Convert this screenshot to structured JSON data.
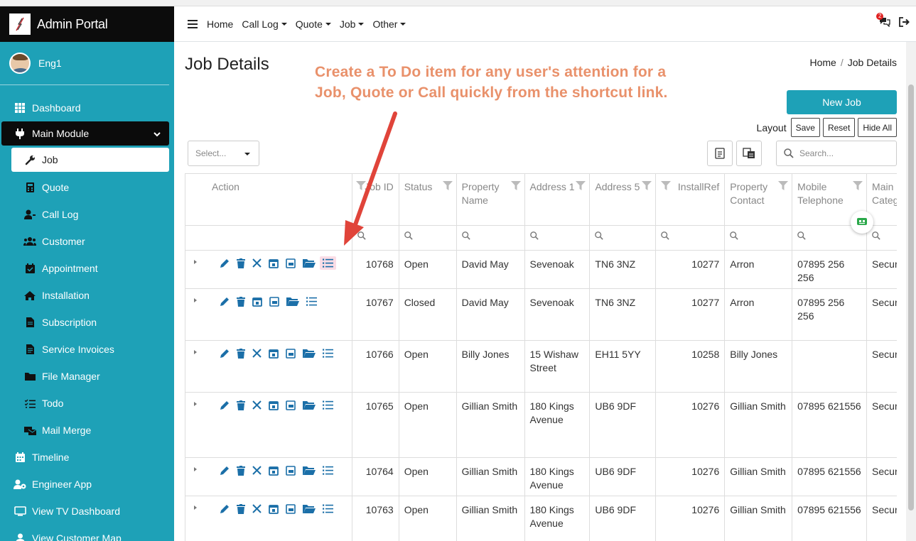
{
  "app": {
    "title": "Admin Portal"
  },
  "user": {
    "name": "Eng1"
  },
  "sidebar": {
    "items_top": [
      {
        "label": "Dashboard",
        "icon": "dashboard-icon"
      }
    ],
    "module": {
      "label": "Main Module",
      "icon": "plug-icon"
    },
    "sub_items": [
      {
        "label": "Job",
        "icon": "wrench-icon",
        "active": true
      },
      {
        "label": "Quote",
        "icon": "calculator-icon"
      },
      {
        "label": "Call Log",
        "icon": "user-call-icon"
      },
      {
        "label": "Customer",
        "icon": "users-icon"
      },
      {
        "label": "Appointment",
        "icon": "calendar-check-icon"
      },
      {
        "label": "Installation",
        "icon": "home-icon"
      },
      {
        "label": "Subscription",
        "icon": "file-icon"
      },
      {
        "label": "Service Invoices",
        "icon": "invoice-icon"
      },
      {
        "label": "File Manager",
        "icon": "folder-icon"
      },
      {
        "label": "Todo",
        "icon": "list-check-icon"
      },
      {
        "label": "Mail Merge",
        "icon": "mail-merge-icon"
      }
    ],
    "items_bottom": [
      {
        "label": "Timeline",
        "icon": "calendar-icon"
      },
      {
        "label": "Engineer App",
        "icon": "users-gear-icon"
      },
      {
        "label": "View TV Dashboard",
        "icon": "tv-icon"
      },
      {
        "label": "View Customer Map",
        "icon": "map-users-icon"
      }
    ]
  },
  "topnav": {
    "home": "Home",
    "menus": [
      "Call Log",
      "Quote",
      "Job",
      "Other"
    ],
    "notification_count": "2"
  },
  "page": {
    "title": "Job Details",
    "breadcrumb_home": "Home",
    "breadcrumb_current": "Job Details",
    "callout_line1": "Create a To Do item for any user's attention for a",
    "callout_line2": "Job, Quote or Call quickly from the shortcut link.",
    "new_job_label": "New Job",
    "layout_label": "Layout",
    "save_label": "Save",
    "reset_label": "Reset",
    "hide_all_label": "Hide All",
    "select_placeholder": "Select...",
    "search_placeholder": "Search..."
  },
  "grid": {
    "columns": {
      "action": "Action",
      "job_id": "Job ID",
      "status": "Status",
      "property_name": "Property Name",
      "address1": "Address 1",
      "address5": "Address 5",
      "install_ref": "InstallRef",
      "property_contact": "Property Contact",
      "mobile": "Mobile Telephone",
      "main_category": "Main Categ"
    },
    "rows": [
      {
        "job_id": "10768",
        "status": "Open",
        "property_name": "David May",
        "address1": "Sevenoak",
        "address5": "TN6 3NZ",
        "install_ref": "10277",
        "contact": "Arron",
        "mobile": "07895 256 256",
        "category": "Securi",
        "has_close": true,
        "highlight_todo": true
      },
      {
        "job_id": "10767",
        "status": "Closed",
        "property_name": "David May",
        "address1": "Sevenoak",
        "address5": "TN6 3NZ",
        "install_ref": "10277",
        "contact": "Arron",
        "mobile": "07895 256 256",
        "category": "Securi",
        "has_close": false,
        "highlight_todo": false
      },
      {
        "job_id": "10766",
        "status": "Open",
        "property_name": "Billy Jones",
        "address1": "15 Wishaw Street",
        "address5": "EH11 5YY",
        "install_ref": "10258",
        "contact": "Billy Jones",
        "mobile": "",
        "category": "Securi",
        "has_close": true,
        "highlight_todo": false
      },
      {
        "job_id": "10765",
        "status": "Open",
        "property_name": "Gillian Smith",
        "address1": "180 Kings Avenue",
        "address5": "UB6 9DF",
        "install_ref": "10276",
        "contact": "Gillian Smith",
        "mobile": "07895 621556",
        "category": "Securi",
        "has_close": true,
        "highlight_todo": false
      },
      {
        "job_id": "10764",
        "status": "Open",
        "property_name": "Gillian Smith",
        "address1": "180 Kings Avenue",
        "address5": "UB6 9DF",
        "install_ref": "10276",
        "contact": "Gillian Smith",
        "mobile": "07895 621556",
        "category": "Securi",
        "has_close": true,
        "highlight_todo": false
      },
      {
        "job_id": "10763",
        "status": "Open",
        "property_name": "Gillian Smith",
        "address1": "180 Kings Avenue",
        "address5": "UB6 9DF",
        "install_ref": "10276",
        "contact": "Gillian Smith",
        "mobile": "07895 621556",
        "category": "Securi",
        "has_close": true,
        "highlight_todo": false
      }
    ]
  },
  "colors": {
    "sidebar": "#1ea1b7",
    "accent": "#1ea1b7",
    "action_icon": "#1b6fa8",
    "callout": "#e9916b",
    "arrow": "#e0443a"
  }
}
